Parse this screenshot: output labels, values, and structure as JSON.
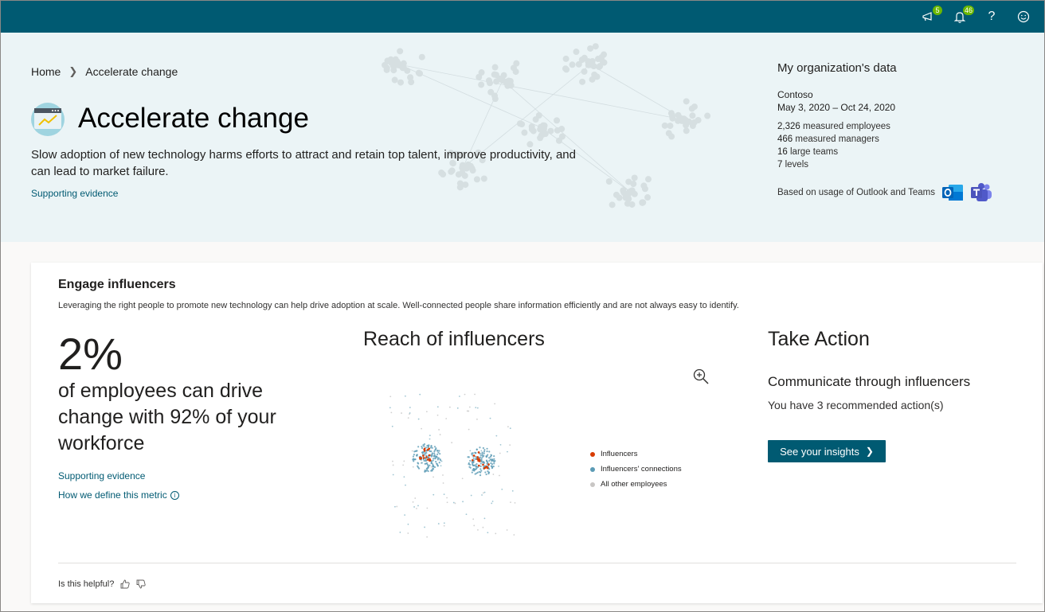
{
  "topbar": {
    "announcement_badge": "5",
    "notification_badge": "46",
    "help_glyph": "?",
    "colors": {
      "bar": "#005a72",
      "badge": "#6bb700"
    }
  },
  "breadcrumb": {
    "home": "Home",
    "current": "Accelerate change"
  },
  "hero": {
    "title": "Accelerate change",
    "description": "Slow adoption of new technology harms efforts to attract and retain top talent, improve productivity, and can lead to market failure.",
    "link": "Supporting evidence"
  },
  "org": {
    "title": "My organization's data",
    "company": "Contoso",
    "date_range": "May 3, 2020 – Oct 24, 2020",
    "stats": [
      {
        "value": "2,326",
        "label": "measured employees"
      },
      {
        "value": "466",
        "label": "measured managers"
      },
      {
        "value": "16",
        "label": "large teams"
      },
      {
        "value": "7",
        "label": "levels"
      }
    ],
    "usage": "Based on usage of Outlook and Teams",
    "apps": [
      "outlook-icon",
      "teams-icon"
    ]
  },
  "card": {
    "title": "Engage influencers",
    "subtitle": "Leveraging the right people to promote new technology can help drive adoption at scale. Well-connected people share information efficiently and are not always easy to identify.",
    "metric": {
      "value": "2%",
      "text": "of employees can drive change with 92% of your workforce",
      "link1": "Supporting evidence",
      "link2": "How we define this metric"
    },
    "chart": {
      "title": "Reach of influencers",
      "legend": [
        {
          "label": "Influencers",
          "color": "#d83b01"
        },
        {
          "label": "Influencers' connections",
          "color": "#5b9bb5"
        },
        {
          "label": "All other employees",
          "color": "#c8c6c4"
        }
      ]
    },
    "action": {
      "title": "Take Action",
      "subtitle": "Communicate through influencers",
      "count_text": "You have 3 recommended action(s)",
      "button": "See your insights"
    },
    "feedback": {
      "label": "Is this helpful?"
    }
  }
}
